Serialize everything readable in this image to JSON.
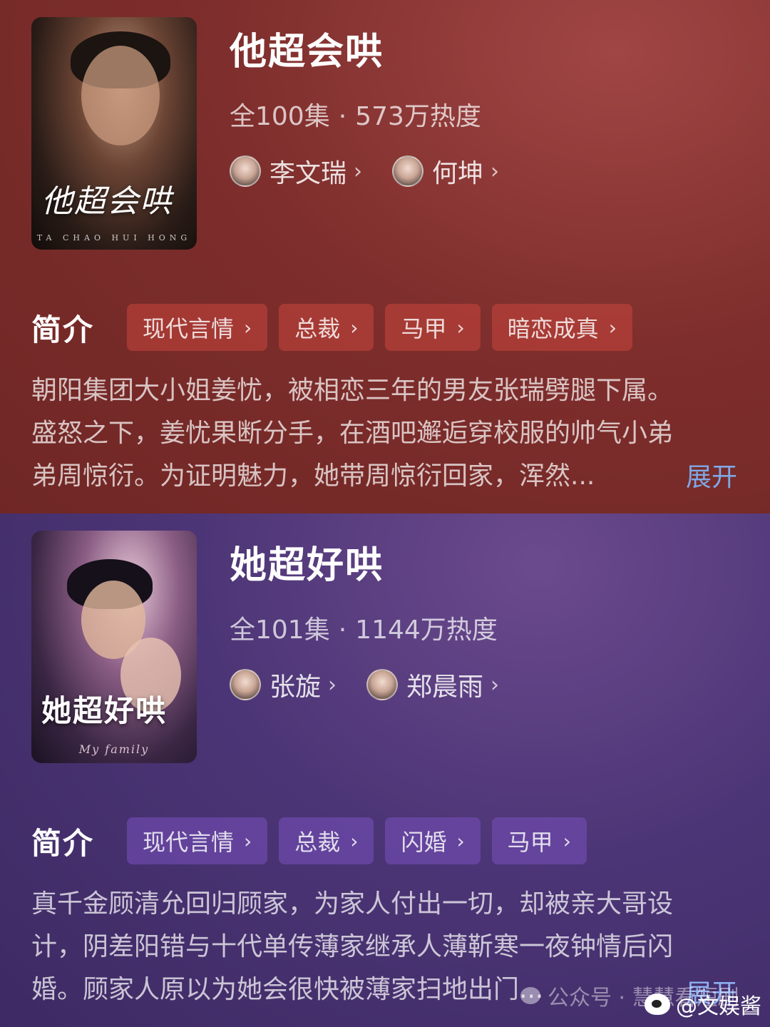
{
  "dramas": [
    {
      "poster_title": "他超会哄",
      "poster_subtitle": "TA CHAO HUI HONG",
      "title": "他超会哄",
      "episodes": "全100集",
      "separator": "·",
      "popularity": "573万热度",
      "actors": [
        {
          "name": "李文瑞",
          "chevron": "›"
        },
        {
          "name": "何坤",
          "chevron": "›"
        }
      ],
      "intro_label": "简介",
      "tags": [
        {
          "label": "现代言情",
          "chevron": "›"
        },
        {
          "label": "总裁",
          "chevron": "›"
        },
        {
          "label": "马甲",
          "chevron": "›"
        },
        {
          "label": "暗恋成真",
          "chevron": "›"
        }
      ],
      "description_lines": [
        "朝阳集团大小姐姜忧，被相恋三年的男友张瑞劈腿下属。",
        "盛怒之下，姜忧果断分手，在酒吧邂逅穿校服的帅气小弟",
        "弟周惊衍。为证明魅力，她带周惊衍回家，浑然..."
      ],
      "expand_label": "展开",
      "accent": "#7e2e2c"
    },
    {
      "poster_title": "她超好哄",
      "poster_subtitle": "My family",
      "title": "她超好哄",
      "episodes": "全101集",
      "separator": "·",
      "popularity": "1144万热度",
      "actors": [
        {
          "name": "张旋",
          "chevron": "›"
        },
        {
          "name": "郑晨雨",
          "chevron": "›"
        }
      ],
      "intro_label": "简介",
      "tags": [
        {
          "label": "现代言情",
          "chevron": "›"
        },
        {
          "label": "总裁",
          "chevron": "›"
        },
        {
          "label": "闪婚",
          "chevron": "›"
        },
        {
          "label": "马甲",
          "chevron": "›"
        }
      ],
      "description_lines": [
        "真千金顾清允回归顾家，为家人付出一切，却被亲大哥设",
        "计，阴差阳错与十代单传薄家继承人薄靳寒一夜钟情后闪",
        "婚。顾家人原以为她会很快被薄家扫地出门..."
      ],
      "expand_label": "展开",
      "accent": "#4c3576"
    }
  ],
  "overlay": {
    "gzh_text": "公众号 · 慧慧看短剧",
    "weibo_handle": "@文娱酱"
  }
}
